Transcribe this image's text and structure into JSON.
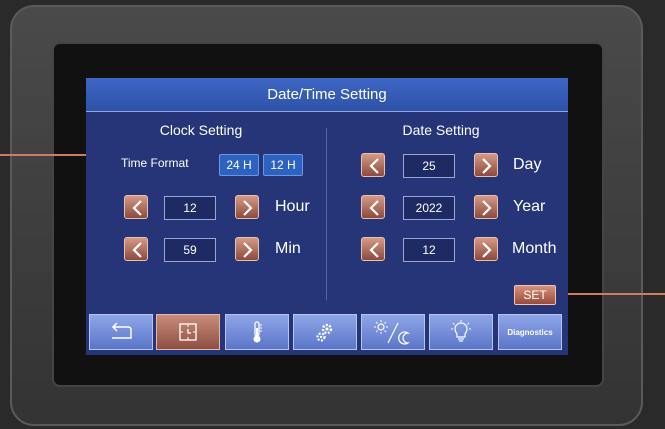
{
  "title": "Date/Time Setting",
  "clock": {
    "title": "Clock Setting",
    "time_format_label": "Time Format",
    "fmt_24": "24 H",
    "fmt_12": "12 H",
    "hour_value": "12",
    "hour_label": "Hour",
    "min_value": "59",
    "min_label": "Min"
  },
  "date": {
    "title": "Date Setting",
    "day_value": "25",
    "day_label": "Day",
    "year_value": "2022",
    "year_label": "Year",
    "month_value": "12",
    "month_label": "Month"
  },
  "set_label": "SET",
  "nav": {
    "diagnostics_label": "Diagnostics",
    "icons": [
      "back-icon",
      "clock-icon",
      "thermometer-icon",
      "gears-icon",
      "day-night-icon",
      "light-bulb-icon"
    ]
  },
  "colors": {
    "screen_bg": "#253577",
    "title_bar": "#2e52a8",
    "arrow_button": "#a85c4b",
    "nav_button": "#6f87d6",
    "leader_line": "#d07d5c"
  }
}
